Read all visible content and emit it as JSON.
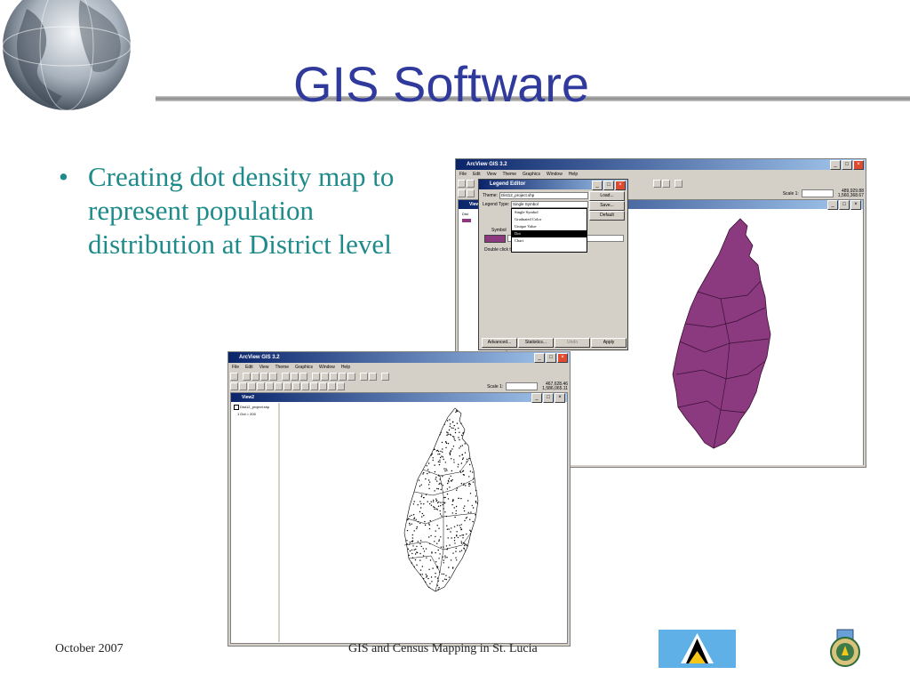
{
  "slide": {
    "title": "GIS Software",
    "bullet": "Creating dot density map to represent population distribution at District level",
    "footer_date": "October 2007",
    "footer_center": "GIS and Census Mapping in St. Lucia"
  },
  "back_window": {
    "title": "ArcView GIS 3.2",
    "menu": [
      "File",
      "Edit",
      "View",
      "Theme",
      "Graphics",
      "Window",
      "Help"
    ],
    "scale_label": "Scale 1:",
    "coords_x": "489,929.88",
    "coords_y": "1,560,368.67",
    "view_title": "View1",
    "toc_label": "Dist"
  },
  "front_window": {
    "title": "ArcView GIS 3.2",
    "menu": [
      "File",
      "Edit",
      "View",
      "Theme",
      "Graphics",
      "Window",
      "Help"
    ],
    "scale_label": "Scale 1:",
    "coords_x": "467,628.46",
    "coords_y": "1,586,065.11",
    "view_title": "View2",
    "toc_theme": "Dist12_project.shp",
    "toc_legend": "1 Dot = 200"
  },
  "legend_editor": {
    "title": "Legend Editor",
    "theme_label": "Theme:",
    "theme_value": "Dist12_project.shp",
    "type_label": "Legend Type:",
    "type_value": "Single Symbol",
    "symbol_label": "Symbol",
    "hint": "Double click the symbol to edit.",
    "options": [
      "Single Symbol",
      "Graduated Color",
      "Unique Value",
      "Dot",
      "Chart"
    ],
    "selected_option": "Dot",
    "side_buttons": [
      "Load...",
      "Save...",
      "Default"
    ],
    "bottom_buttons": [
      "Advanced...",
      "Statistics...",
      "Undo",
      "Apply"
    ]
  },
  "colors": {
    "title": "#2f3a9c",
    "bullet": "#1e8a8a",
    "district_fill": "#8b3a7f",
    "titlebar": "#0a246a"
  }
}
